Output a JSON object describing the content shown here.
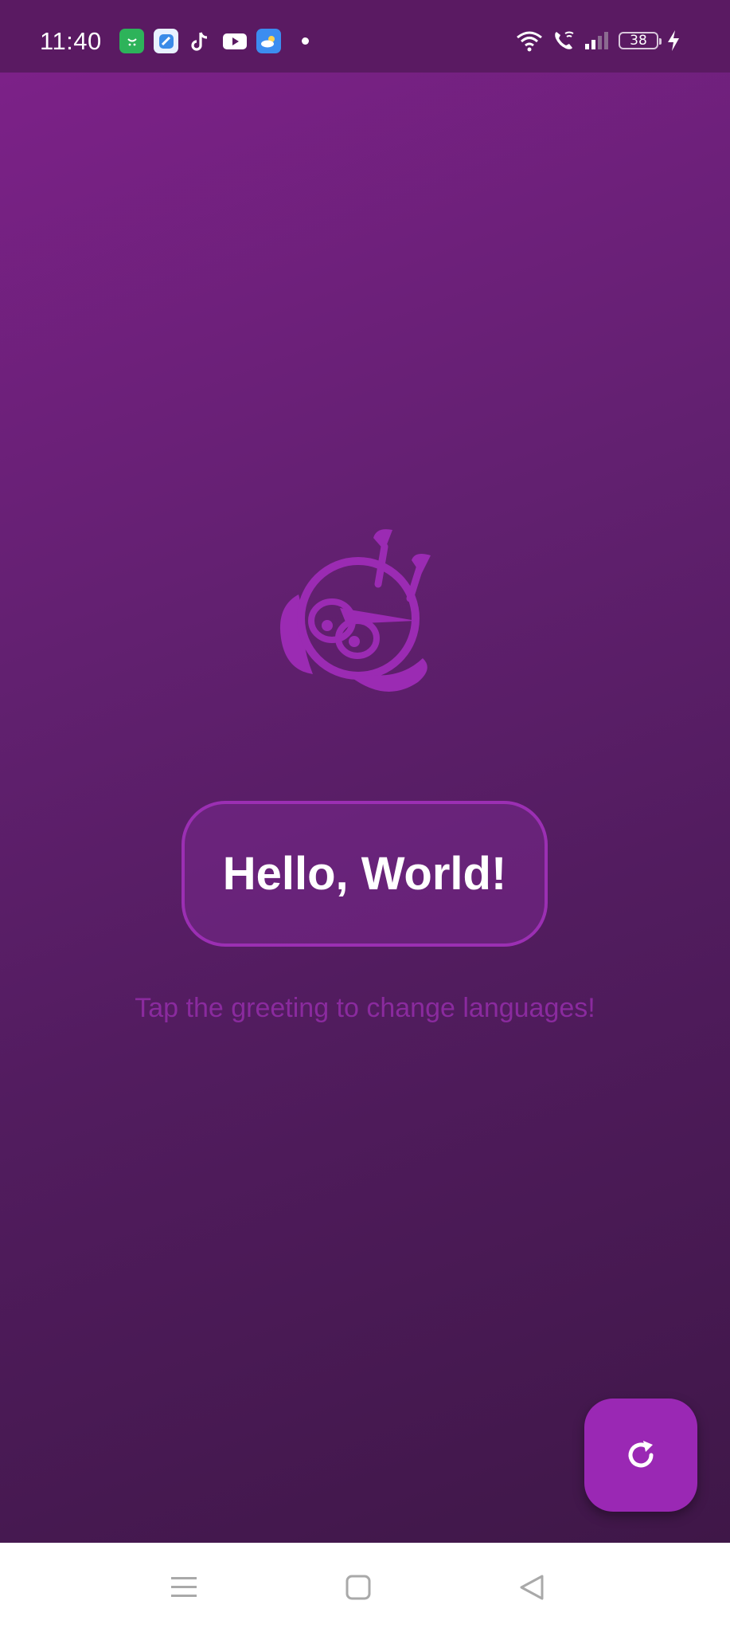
{
  "status_bar": {
    "time": "11:40",
    "battery_level": "38",
    "notification_icons": [
      "app-store-icon",
      "messaging-app-icon",
      "tiktok-icon",
      "youtube-icon",
      "weather-icon"
    ]
  },
  "main": {
    "greeting": "Hello, World!",
    "hint": "Tap the greeting to change languages!"
  },
  "colors": {
    "accent": "#9a28b4",
    "background_top": "#7c2188",
    "background_bottom": "#3f1748",
    "hint_text": "#8a2a9e"
  },
  "fab": {
    "icon": "refresh-icon"
  },
  "navigation_bar": {
    "buttons": [
      "menu-icon",
      "home-icon",
      "back-icon"
    ]
  }
}
